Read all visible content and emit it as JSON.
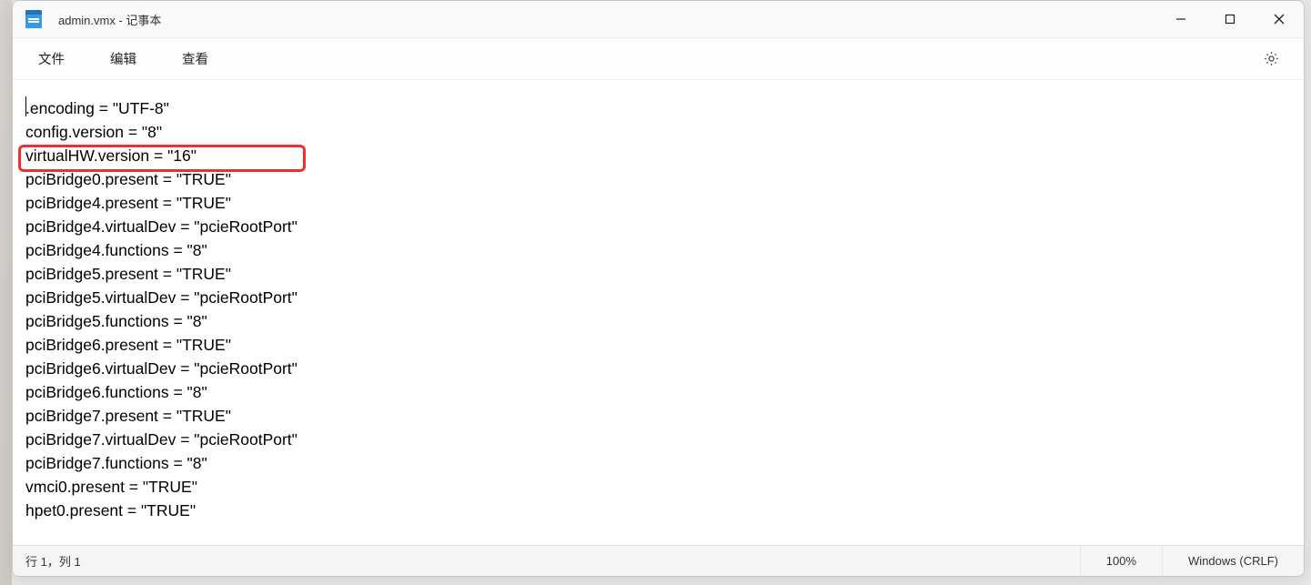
{
  "title": "admin.vmx - 记事本",
  "menu": {
    "file": "文件",
    "edit": "编辑",
    "view": "查看"
  },
  "lines": [
    ".encoding = \"UTF-8\"",
    "config.version = \"8\"",
    "virtualHW.version = \"16\"",
    "pciBridge0.present = \"TRUE\"",
    "pciBridge4.present = \"TRUE\"",
    "pciBridge4.virtualDev = \"pcieRootPort\"",
    "pciBridge4.functions = \"8\"",
    "pciBridge5.present = \"TRUE\"",
    "pciBridge5.virtualDev = \"pcieRootPort\"",
    "pciBridge5.functions = \"8\"",
    "pciBridge6.present = \"TRUE\"",
    "pciBridge6.virtualDev = \"pcieRootPort\"",
    "pciBridge6.functions = \"8\"",
    "pciBridge7.present = \"TRUE\"",
    "pciBridge7.virtualDev = \"pcieRootPort\"",
    "pciBridge7.functions = \"8\"",
    "vmci0.present = \"TRUE\"",
    "hpet0.present = \"TRUE\""
  ],
  "highlighted_line_index": 2,
  "status": {
    "pos": "行 1，列 1",
    "zoom": "100%",
    "eol": "Windows (CRLF)"
  }
}
